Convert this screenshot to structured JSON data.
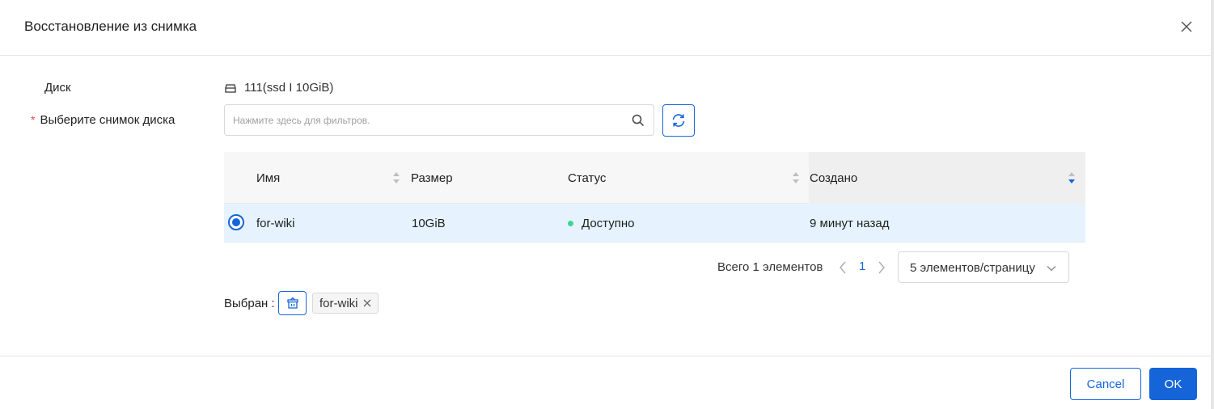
{
  "dialog": {
    "title": "Восстановление из снимка"
  },
  "form": {
    "disk_label": "Диск",
    "disk_value": "111(ssd I 10GiB)",
    "snapshot_label": "Выберите снимок диска",
    "required_mark": "*"
  },
  "search": {
    "placeholder": "Нажмите здесь для фильтров."
  },
  "table": {
    "columns": [
      "Имя",
      "Размер",
      "Статус",
      "Создано"
    ],
    "rows": [
      {
        "name": "for-wiki",
        "size": "10GiB",
        "status": "Доступно",
        "created": "9 минут назад",
        "selected": true
      }
    ]
  },
  "pagination": {
    "total": "Всего 1 элементов",
    "current_page": "1",
    "page_size": "5 элементов/страницу"
  },
  "selection": {
    "label": "Выбран :",
    "tag": "for-wiki"
  },
  "footer": {
    "cancel": "Cancel",
    "ok": "OK"
  },
  "colors": {
    "primary": "#1565d8",
    "selected_row": "#e6f3ff",
    "status_ok": "#3dd68c",
    "required": "#e5484d"
  }
}
